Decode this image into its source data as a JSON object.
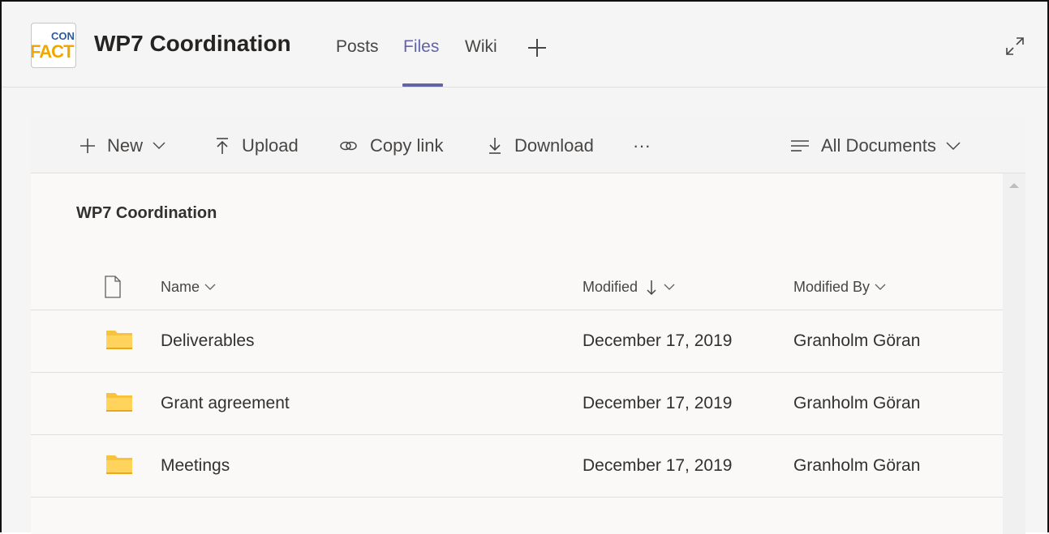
{
  "header": {
    "logo_top": "CON",
    "logo_bottom": "FACT",
    "team_title": "WP7 Coordination",
    "tabs": [
      {
        "label": "Posts",
        "active": false
      },
      {
        "label": "Files",
        "active": true
      },
      {
        "label": "Wiki",
        "active": false
      }
    ],
    "accent_color": "#6264a7"
  },
  "toolbar": {
    "new_label": "New",
    "upload_label": "Upload",
    "copy_link_label": "Copy link",
    "download_label": "Download",
    "more_label": "···",
    "view_label": "All Documents"
  },
  "library": {
    "title": "WP7 Coordination",
    "columns": {
      "name": "Name",
      "modified": "Modified",
      "modified_by": "Modified By"
    },
    "rows": [
      {
        "name": "Deliverables",
        "modified": "December 17, 2019",
        "modified_by": "Granholm Göran"
      },
      {
        "name": "Grant agreement",
        "modified": "December 17, 2019",
        "modified_by": "Granholm Göran"
      },
      {
        "name": "Meetings",
        "modified": "December 17, 2019",
        "modified_by": "Granholm Göran"
      }
    ]
  },
  "icons": {
    "folder_color": "#f8c33c"
  }
}
